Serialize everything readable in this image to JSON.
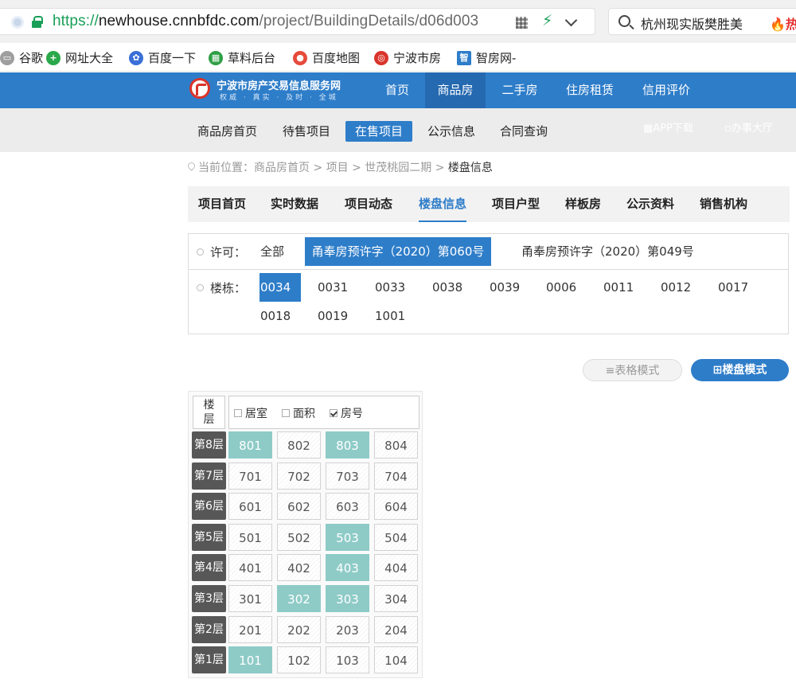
{
  "browser": {
    "url_protocol": "https://",
    "url_host": "newhouse.cnnbfdc.com",
    "url_path": "/project/BuildingDetails/d06d003",
    "search_text": "杭州现实版樊胜美",
    "search_hot": "热",
    "bookmarks": [
      {
        "label": "谷歌",
        "icon": "page-icon",
        "color": "#9e9e9e"
      },
      {
        "label": "网址大全",
        "icon": "plus-circle-icon",
        "color": "#2aa84a"
      },
      {
        "label": "百度一下",
        "icon": "paw-icon",
        "color": "#3a6fd8"
      },
      {
        "label": "草料后台",
        "icon": "grid-icon",
        "color": "#2f9f45"
      },
      {
        "label": "百度地图",
        "icon": "map-pin-icon",
        "color": "#e64b3c"
      },
      {
        "label": "宁波市房",
        "icon": "site-logo-icon",
        "color": "#d9342b"
      },
      {
        "label": "智房网-",
        "icon": "zhi-icon",
        "color": "#2e7dc9"
      }
    ]
  },
  "site": {
    "logo_title": "宁波市房产交易信息服务网",
    "logo_slogan": "权威 · 真实 · 及时 · 全城",
    "nav": [
      "首页",
      "商品房",
      "二手房",
      "住房租赁",
      "信用评价"
    ],
    "nav_active": "商品房",
    "subnav": [
      "商品房首页",
      "待售项目",
      "在售项目",
      "公示信息",
      "合同查询"
    ],
    "subnav_active": "在售项目",
    "subnav_right": [
      "APP下载",
      "办事大厅"
    ]
  },
  "breadcrumb": {
    "prefix": "当前位置：",
    "items": [
      "商品房首页",
      "项目",
      "世茂桃园二期"
    ],
    "current": "楼盘信息"
  },
  "project_tabs": [
    "项目首页",
    "实时数据",
    "项目动态",
    "楼盘信息",
    "项目户型",
    "样板房",
    "公示资料",
    "销售机构"
  ],
  "project_tab_active": "楼盘信息",
  "filter": {
    "permit_label": "许可：",
    "permits": [
      "全部",
      "甬奉房预许字（2020）第060号",
      "甬奉房预许字（2020）第049号"
    ],
    "permit_active": "甬奉房预许字（2020）第060号",
    "building_label": "楼栋：",
    "buildings": [
      "0034",
      "0031",
      "0033",
      "0038",
      "0039",
      "0006",
      "0011",
      "0012",
      "0017",
      "0018",
      "0019",
      "1001"
    ],
    "building_active": "0034"
  },
  "modes": {
    "table": "≡表格模式",
    "building": "楼盘模式"
  },
  "grid": {
    "corner": "楼层",
    "legend": [
      {
        "label": "居室",
        "checked": false
      },
      {
        "label": "面积",
        "checked": false
      },
      {
        "label": "房号",
        "checked": true
      }
    ],
    "floors": [
      {
        "label": "第8层",
        "rooms": [
          {
            "no": "801",
            "sold": true
          },
          {
            "no": "802",
            "sold": false
          },
          {
            "no": "803",
            "sold": true
          },
          {
            "no": "804",
            "sold": false
          }
        ]
      },
      {
        "label": "第7层",
        "rooms": [
          {
            "no": "701",
            "sold": false
          },
          {
            "no": "702",
            "sold": false
          },
          {
            "no": "703",
            "sold": false
          },
          {
            "no": "704",
            "sold": false
          }
        ]
      },
      {
        "label": "第6层",
        "rooms": [
          {
            "no": "601",
            "sold": false
          },
          {
            "no": "602",
            "sold": false
          },
          {
            "no": "603",
            "sold": false
          },
          {
            "no": "604",
            "sold": false
          }
        ]
      },
      {
        "label": "第5层",
        "rooms": [
          {
            "no": "501",
            "sold": false
          },
          {
            "no": "502",
            "sold": false
          },
          {
            "no": "503",
            "sold": true
          },
          {
            "no": "504",
            "sold": false
          }
        ]
      },
      {
        "label": "第4层",
        "rooms": [
          {
            "no": "401",
            "sold": false
          },
          {
            "no": "402",
            "sold": false
          },
          {
            "no": "403",
            "sold": true
          },
          {
            "no": "404",
            "sold": false
          }
        ]
      },
      {
        "label": "第3层",
        "rooms": [
          {
            "no": "301",
            "sold": false
          },
          {
            "no": "302",
            "sold": true
          },
          {
            "no": "303",
            "sold": true
          },
          {
            "no": "304",
            "sold": false
          }
        ]
      },
      {
        "label": "第2层",
        "rooms": [
          {
            "no": "201",
            "sold": false
          },
          {
            "no": "202",
            "sold": false
          },
          {
            "no": "203",
            "sold": false
          },
          {
            "no": "204",
            "sold": false
          }
        ]
      },
      {
        "label": "第1层",
        "rooms": [
          {
            "no": "101",
            "sold": true
          },
          {
            "no": "102",
            "sold": false
          },
          {
            "no": "103",
            "sold": false
          },
          {
            "no": "104",
            "sold": false
          }
        ]
      }
    ]
  },
  "colors": {
    "primary": "#2e7dc9",
    "sold_room": "#8ecbc7",
    "floor_label": "#575757"
  }
}
